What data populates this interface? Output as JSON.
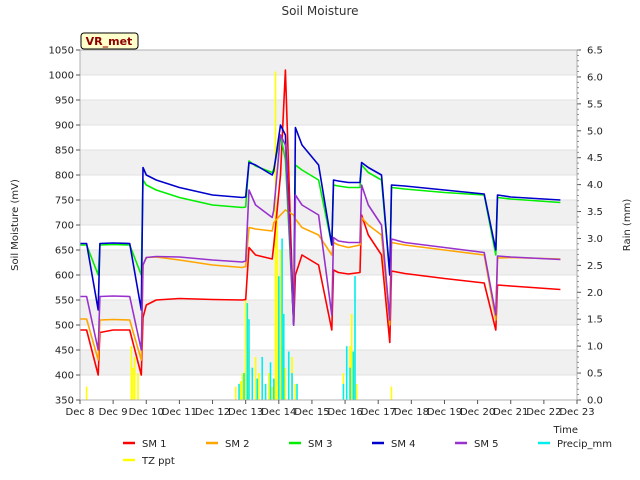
{
  "chart_data": {
    "type": "line",
    "title": "Soil Moisture",
    "badge": "VR_met",
    "xlabel": "Time",
    "ylabel_left": "Soil Moisture (mV)",
    "ylabel_right": "Rain (mm)",
    "ylim_left": [
      350,
      1050
    ],
    "ylim_right": [
      0.0,
      6.5
    ],
    "xlim": [
      8,
      23
    ],
    "y_ticks_left": [
      350,
      400,
      450,
      500,
      550,
      600,
      650,
      700,
      750,
      800,
      850,
      900,
      950,
      1000,
      1050
    ],
    "y_ticks_right": [
      "0.0",
      "0.5",
      "1.0",
      "1.5",
      "2.0",
      "2.5",
      "3.0",
      "3.5",
      "4.0",
      "4.5",
      "5.0",
      "5.5",
      "6.0",
      "6.5"
    ],
    "x_ticks": [
      "Dec 8",
      "Dec 9",
      "Dec 10",
      "Dec 11",
      "Dec 12",
      "Dec 13",
      "Dec 14",
      "Dec 15",
      "Dec 16",
      "Dec 17",
      "Dec 18",
      "Dec 19",
      "Dec 20",
      "Dec 21",
      "Dec 22",
      "Dec 23"
    ],
    "grid": "horizontal bands",
    "legend_placement": "bottom",
    "series": [
      {
        "name": "SM 1",
        "color": "#ff0000",
        "axis": "left",
        "x": [
          8.0,
          8.2,
          8.55,
          8.6,
          9.0,
          9.5,
          9.85,
          9.9,
          10.0,
          10.3,
          11.0,
          12.0,
          12.9,
          13.0,
          13.1,
          13.3,
          13.8,
          13.85,
          14.05,
          14.2,
          14.45,
          14.5,
          14.7,
          15.2,
          15.6,
          15.65,
          15.8,
          16.1,
          16.45,
          16.5,
          16.7,
          17.1,
          17.35,
          17.4,
          17.8,
          19.0,
          20.2,
          20.55,
          20.6,
          21.0,
          22.5
        ],
        "y": [
          490,
          490,
          400,
          485,
          490,
          490,
          400,
          515,
          540,
          550,
          553,
          551,
          550,
          551,
          655,
          640,
          632,
          660,
          800,
          1010,
          500,
          600,
          640,
          620,
          490,
          610,
          605,
          602,
          605,
          720,
          680,
          640,
          465,
          608,
          603,
          593,
          584,
          490,
          580,
          578,
          571
        ]
      },
      {
        "name": "SM 2",
        "color": "#ffa500",
        "axis": "left",
        "x": [
          8.0,
          8.2,
          8.55,
          8.6,
          9.0,
          9.5,
          9.85,
          9.9,
          10.0,
          10.3,
          11.0,
          12.0,
          12.9,
          13.0,
          13.1,
          13.3,
          13.8,
          13.85,
          14.05,
          14.2,
          14.45,
          14.5,
          14.7,
          15.2,
          15.6,
          15.65,
          15.8,
          16.1,
          16.45,
          16.5,
          16.7,
          17.1,
          17.35,
          17.4,
          17.8,
          19.0,
          20.2,
          20.55,
          20.6,
          21.0,
          22.5
        ],
        "y": [
          512,
          512,
          430,
          510,
          511,
          510,
          430,
          620,
          635,
          636,
          630,
          620,
          615,
          617,
          695,
          692,
          688,
          705,
          720,
          730,
          720,
          712,
          695,
          680,
          640,
          665,
          660,
          655,
          660,
          715,
          700,
          680,
          500,
          665,
          660,
          650,
          640,
          510,
          634,
          635,
          632
        ]
      },
      {
        "name": "SM 3",
        "color": "#00ee00",
        "axis": "left",
        "x": [
          8.0,
          8.2,
          8.55,
          8.6,
          9.0,
          9.5,
          9.85,
          9.9,
          10.0,
          10.3,
          11.0,
          12.0,
          12.9,
          13.0,
          13.1,
          13.3,
          13.8,
          13.85,
          14.05,
          14.2,
          14.45,
          14.5,
          14.7,
          15.2,
          15.6,
          15.65,
          15.8,
          16.1,
          16.45,
          16.5,
          16.7,
          17.1,
          17.35,
          17.4,
          17.8,
          19.0,
          20.2,
          20.55,
          20.6,
          21.0,
          22.5
        ],
        "y": [
          660,
          660,
          600,
          660,
          661,
          660,
          600,
          790,
          780,
          770,
          755,
          740,
          735,
          736,
          828,
          818,
          805,
          812,
          880,
          830,
          500,
          820,
          810,
          790,
          660,
          780,
          778,
          775,
          775,
          820,
          805,
          790,
          600,
          775,
          772,
          765,
          760,
          640,
          755,
          752,
          745
        ]
      },
      {
        "name": "SM 4",
        "color": "#0000cc",
        "axis": "left",
        "x": [
          8.0,
          8.2,
          8.55,
          8.6,
          9.0,
          9.5,
          9.85,
          9.9,
          10.0,
          10.3,
          11.0,
          12.0,
          12.9,
          13.0,
          13.1,
          13.3,
          13.8,
          13.85,
          14.05,
          14.2,
          14.45,
          14.5,
          14.7,
          15.2,
          15.6,
          15.65,
          15.8,
          16.1,
          16.45,
          16.5,
          16.7,
          17.1,
          17.35,
          17.4,
          17.8,
          19.0,
          20.2,
          20.55,
          20.6,
          21.0,
          22.5
        ],
        "y": [
          663,
          663,
          530,
          663,
          664,
          663,
          530,
          815,
          800,
          790,
          775,
          760,
          755,
          756,
          825,
          820,
          800,
          808,
          900,
          880,
          500,
          895,
          860,
          820,
          660,
          790,
          788,
          785,
          785,
          825,
          815,
          800,
          600,
          780,
          778,
          770,
          762,
          650,
          760,
          756,
          750
        ]
      },
      {
        "name": "SM 5",
        "color": "#9932cc",
        "axis": "left",
        "x": [
          8.0,
          8.2,
          8.55,
          8.6,
          9.0,
          9.5,
          9.85,
          9.9,
          10.0,
          10.3,
          11.0,
          12.0,
          12.9,
          13.0,
          13.1,
          13.3,
          13.8,
          13.85,
          14.05,
          14.2,
          14.45,
          14.5,
          14.7,
          15.2,
          15.6,
          15.65,
          15.8,
          16.1,
          16.45,
          16.5,
          16.7,
          17.1,
          17.35,
          17.4,
          17.8,
          19.0,
          20.2,
          20.55,
          20.6,
          21.0,
          22.5
        ],
        "y": [
          557,
          557,
          450,
          557,
          558,
          557,
          450,
          620,
          635,
          637,
          636,
          630,
          626,
          628,
          770,
          740,
          715,
          730,
          880,
          860,
          500,
          760,
          740,
          720,
          520,
          675,
          668,
          665,
          665,
          780,
          740,
          700,
          510,
          672,
          665,
          655,
          645,
          520,
          638,
          636,
          631
        ]
      },
      {
        "name": "Precip_mm",
        "color": "#00eeee",
        "axis": "right",
        "bars": [
          [
            12.8,
            0.3
          ],
          [
            12.95,
            0.5
          ],
          [
            13.05,
            1.8
          ],
          [
            13.1,
            1.5
          ],
          [
            13.2,
            0.6
          ],
          [
            13.35,
            0.4
          ],
          [
            13.5,
            0.8
          ],
          [
            13.6,
            0.3
          ],
          [
            13.75,
            0.7
          ],
          [
            13.85,
            0.4
          ],
          [
            14.0,
            2.3
          ],
          [
            14.1,
            3.0
          ],
          [
            14.15,
            1.6
          ],
          [
            14.3,
            0.9
          ],
          [
            14.4,
            0.5
          ],
          [
            14.55,
            0.3
          ],
          [
            15.95,
            0.3
          ],
          [
            16.05,
            1.0
          ],
          [
            16.15,
            0.6
          ],
          [
            16.25,
            0.9
          ],
          [
            16.3,
            2.3
          ]
        ]
      },
      {
        "name": "TZ ppt",
        "color": "#ffff00",
        "axis": "right",
        "bars": [
          [
            8.2,
            0.25
          ],
          [
            9.55,
            1.0
          ],
          [
            9.6,
            0.6
          ],
          [
            9.65,
            0.8
          ],
          [
            9.75,
            0.5
          ],
          [
            12.7,
            0.25
          ],
          [
            12.85,
            0.35
          ],
          [
            12.9,
            0.5
          ],
          [
            13.0,
            1.9
          ],
          [
            13.1,
            0.9
          ],
          [
            13.2,
            0.6
          ],
          [
            13.3,
            0.8
          ],
          [
            13.4,
            0.5
          ],
          [
            13.5,
            0.4
          ],
          [
            13.6,
            0.3
          ],
          [
            13.7,
            0.5
          ],
          [
            13.8,
            0.25
          ],
          [
            13.9,
            6.1
          ],
          [
            13.95,
            3.5
          ],
          [
            14.0,
            1.8
          ],
          [
            14.05,
            2.8
          ],
          [
            14.1,
            1.0
          ],
          [
            14.2,
            0.6
          ],
          [
            14.3,
            0.4
          ],
          [
            14.4,
            0.8
          ],
          [
            14.5,
            0.3
          ],
          [
            15.95,
            0.5
          ],
          [
            16.05,
            0.3
          ],
          [
            16.15,
            1.0
          ],
          [
            16.2,
            1.6
          ],
          [
            16.25,
            0.7
          ],
          [
            16.35,
            0.3
          ],
          [
            17.4,
            0.25
          ]
        ]
      }
    ]
  }
}
